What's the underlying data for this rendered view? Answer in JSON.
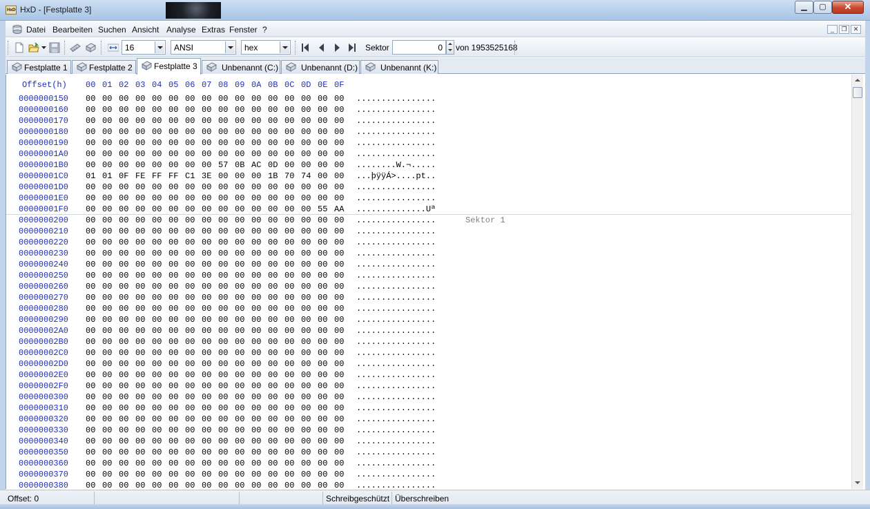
{
  "window": {
    "title": "HxD - [Festplatte 3]",
    "app_icon_text": "HxD"
  },
  "menu": {
    "items": [
      "Datei",
      "Bearbeiten",
      "Suchen",
      "Ansicht",
      "Analyse",
      "Extras",
      "Fenster",
      "?"
    ]
  },
  "toolbar": {
    "bytes_per_row": "16",
    "charset": "ANSI",
    "offset_base": "hex",
    "sector_label": "Sektor",
    "sector_value": "0",
    "sector_total": "von 1953525168"
  },
  "tabs": [
    {
      "label": "Festplatte 1",
      "active": false
    },
    {
      "label": "Festplatte 2",
      "active": false
    },
    {
      "label": "Festplatte 3",
      "active": true
    },
    {
      "label": "Unbenannt (C:)",
      "active": false
    },
    {
      "label": "Unbenannt (D:)",
      "active": false
    },
    {
      "label": "Unbenannt (K:)",
      "active": false
    }
  ],
  "hex": {
    "offset_header": "Offset(h)",
    "column_headers": [
      "00",
      "01",
      "02",
      "03",
      "04",
      "05",
      "06",
      "07",
      "08",
      "09",
      "0A",
      "0B",
      "0C",
      "0D",
      "0E",
      "0F"
    ],
    "sector_marker": "Sektor 1",
    "rows": [
      {
        "offset": "0000000150",
        "bytes": "00 00 00 00 00 00 00 00 00 00 00 00 00 00 00 00",
        "ascii": "................"
      },
      {
        "offset": "0000000160",
        "bytes": "00 00 00 00 00 00 00 00 00 00 00 00 00 00 00 00",
        "ascii": "................"
      },
      {
        "offset": "0000000170",
        "bytes": "00 00 00 00 00 00 00 00 00 00 00 00 00 00 00 00",
        "ascii": "................"
      },
      {
        "offset": "0000000180",
        "bytes": "00 00 00 00 00 00 00 00 00 00 00 00 00 00 00 00",
        "ascii": "................"
      },
      {
        "offset": "0000000190",
        "bytes": "00 00 00 00 00 00 00 00 00 00 00 00 00 00 00 00",
        "ascii": "................"
      },
      {
        "offset": "00000001A0",
        "bytes": "00 00 00 00 00 00 00 00 00 00 00 00 00 00 00 00",
        "ascii": "................"
      },
      {
        "offset": "00000001B0",
        "bytes": "00 00 00 00 00 00 00 00 57 0B AC 0D 00 00 00 00",
        "ascii": "........W.¬....."
      },
      {
        "offset": "00000001C0",
        "bytes": "01 01 0F FE FF FF C1 3E 00 00 00 1B 70 74 00 00",
        "ascii": "...þÿÿÁ>....pt.."
      },
      {
        "offset": "00000001D0",
        "bytes": "00 00 00 00 00 00 00 00 00 00 00 00 00 00 00 00",
        "ascii": "................"
      },
      {
        "offset": "00000001E0",
        "bytes": "00 00 00 00 00 00 00 00 00 00 00 00 00 00 00 00",
        "ascii": "................"
      },
      {
        "offset": "00000001F0",
        "bytes": "00 00 00 00 00 00 00 00 00 00 00 00 00 00 55 AA",
        "ascii": "..............Uª"
      },
      {
        "offset": "0000000200",
        "bytes": "00 00 00 00 00 00 00 00 00 00 00 00 00 00 00 00",
        "ascii": "................",
        "sector_start": true
      },
      {
        "offset": "0000000210",
        "bytes": "00 00 00 00 00 00 00 00 00 00 00 00 00 00 00 00",
        "ascii": "................"
      },
      {
        "offset": "0000000220",
        "bytes": "00 00 00 00 00 00 00 00 00 00 00 00 00 00 00 00",
        "ascii": "................"
      },
      {
        "offset": "0000000230",
        "bytes": "00 00 00 00 00 00 00 00 00 00 00 00 00 00 00 00",
        "ascii": "................"
      },
      {
        "offset": "0000000240",
        "bytes": "00 00 00 00 00 00 00 00 00 00 00 00 00 00 00 00",
        "ascii": "................"
      },
      {
        "offset": "0000000250",
        "bytes": "00 00 00 00 00 00 00 00 00 00 00 00 00 00 00 00",
        "ascii": "................"
      },
      {
        "offset": "0000000260",
        "bytes": "00 00 00 00 00 00 00 00 00 00 00 00 00 00 00 00",
        "ascii": "................"
      },
      {
        "offset": "0000000270",
        "bytes": "00 00 00 00 00 00 00 00 00 00 00 00 00 00 00 00",
        "ascii": "................"
      },
      {
        "offset": "0000000280",
        "bytes": "00 00 00 00 00 00 00 00 00 00 00 00 00 00 00 00",
        "ascii": "................"
      },
      {
        "offset": "0000000290",
        "bytes": "00 00 00 00 00 00 00 00 00 00 00 00 00 00 00 00",
        "ascii": "................"
      },
      {
        "offset": "00000002A0",
        "bytes": "00 00 00 00 00 00 00 00 00 00 00 00 00 00 00 00",
        "ascii": "................"
      },
      {
        "offset": "00000002B0",
        "bytes": "00 00 00 00 00 00 00 00 00 00 00 00 00 00 00 00",
        "ascii": "................"
      },
      {
        "offset": "00000002C0",
        "bytes": "00 00 00 00 00 00 00 00 00 00 00 00 00 00 00 00",
        "ascii": "................"
      },
      {
        "offset": "00000002D0",
        "bytes": "00 00 00 00 00 00 00 00 00 00 00 00 00 00 00 00",
        "ascii": "................"
      },
      {
        "offset": "00000002E0",
        "bytes": "00 00 00 00 00 00 00 00 00 00 00 00 00 00 00 00",
        "ascii": "................"
      },
      {
        "offset": "00000002F0",
        "bytes": "00 00 00 00 00 00 00 00 00 00 00 00 00 00 00 00",
        "ascii": "................"
      },
      {
        "offset": "0000000300",
        "bytes": "00 00 00 00 00 00 00 00 00 00 00 00 00 00 00 00",
        "ascii": "................"
      },
      {
        "offset": "0000000310",
        "bytes": "00 00 00 00 00 00 00 00 00 00 00 00 00 00 00 00",
        "ascii": "................"
      },
      {
        "offset": "0000000320",
        "bytes": "00 00 00 00 00 00 00 00 00 00 00 00 00 00 00 00",
        "ascii": "................"
      },
      {
        "offset": "0000000330",
        "bytes": "00 00 00 00 00 00 00 00 00 00 00 00 00 00 00 00",
        "ascii": "................"
      },
      {
        "offset": "0000000340",
        "bytes": "00 00 00 00 00 00 00 00 00 00 00 00 00 00 00 00",
        "ascii": "................"
      },
      {
        "offset": "0000000350",
        "bytes": "00 00 00 00 00 00 00 00 00 00 00 00 00 00 00 00",
        "ascii": "................"
      },
      {
        "offset": "0000000360",
        "bytes": "00 00 00 00 00 00 00 00 00 00 00 00 00 00 00 00",
        "ascii": "................"
      },
      {
        "offset": "0000000370",
        "bytes": "00 00 00 00 00 00 00 00 00 00 00 00 00 00 00 00",
        "ascii": "................"
      },
      {
        "offset": "0000000380",
        "bytes": "00 00 00 00 00 00 00 00 00 00 00 00 00 00 00 00",
        "ascii": "................"
      }
    ]
  },
  "status": {
    "offset": "Offset: 0",
    "readonly": "Schreibgeschützt",
    "mode": "Überschreiben"
  },
  "colors": {
    "offset_blue": "#1d2fbf",
    "sector_gray": "#808080"
  },
  "icons": [
    "app-icon",
    "document-icon",
    "new-file-icon",
    "open-folder-icon",
    "save-icon",
    "disk-icon",
    "ram-icon",
    "bytes-per-row-icon",
    "first-sector-icon",
    "prev-sector-icon",
    "next-sector-icon",
    "last-sector-icon",
    "disk-tab-icon"
  ]
}
